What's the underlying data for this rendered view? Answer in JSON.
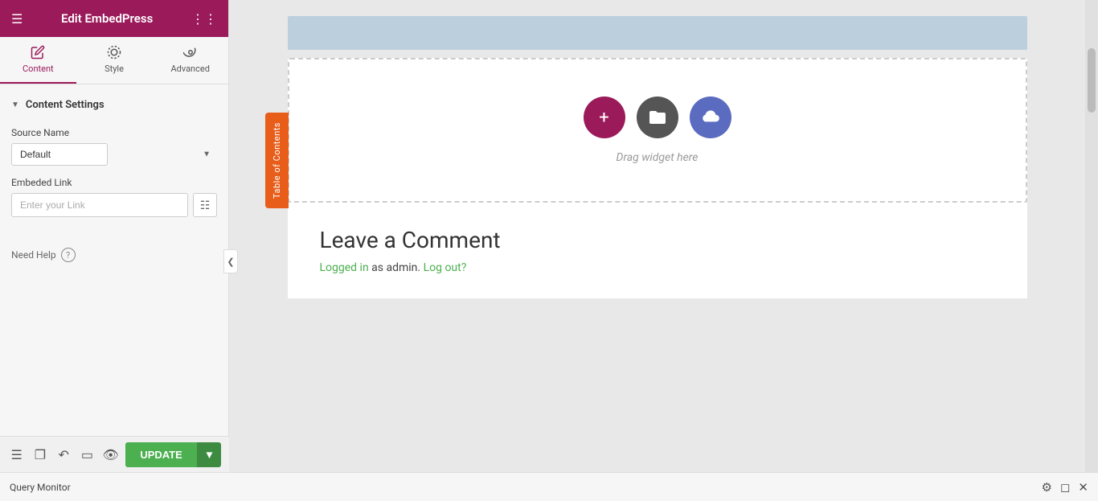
{
  "header": {
    "title": "Edit EmbedPress",
    "menu_icon": "≡",
    "grid_icon": "⊞"
  },
  "tabs": [
    {
      "id": "content",
      "label": "Content",
      "icon": "✎",
      "active": true
    },
    {
      "id": "style",
      "label": "Style",
      "icon": "◑",
      "active": false
    },
    {
      "id": "advanced",
      "label": "Advanced",
      "icon": "⚙",
      "active": false
    }
  ],
  "content_settings": {
    "section_label": "Content Settings",
    "source_name_label": "Source Name",
    "source_name_default": "Default",
    "source_options": [
      "Default"
    ],
    "embed_link_label": "Embeded Link",
    "embed_link_placeholder": "Enter your Link"
  },
  "toc_tab": {
    "label": "Table of Contents"
  },
  "need_help": {
    "label": "Need Help"
  },
  "drag_zone": {
    "text": "Drag widget here"
  },
  "toolbar": {
    "update_label": "UPDATE"
  },
  "comment_section": {
    "title": "Leave a Comment",
    "subtitle_logged_in": "Logged in",
    "subtitle_as": "as admin.",
    "subtitle_logout": "Log out?"
  },
  "query_monitor": {
    "label": "Query Monitor"
  },
  "colors": {
    "brand": "#9b1a5a",
    "green": "#4caf50",
    "orange": "#e85d1a",
    "folder_grey": "#555555",
    "cloud_purple": "#5b6bc0"
  }
}
